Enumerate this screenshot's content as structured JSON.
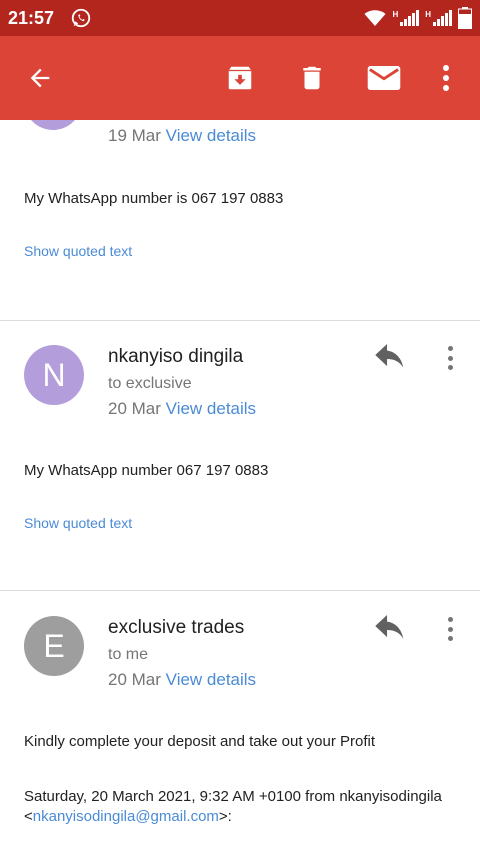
{
  "status_bar": {
    "time": "21:57",
    "network_label": "H"
  },
  "app_bar": {
    "back_icon": "arrow-back-icon",
    "archive_icon": "archive-icon",
    "delete_icon": "trash-icon",
    "mark_unread_icon": "mail-icon",
    "more_icon": "more-vert-icon"
  },
  "messages": [
    {
      "date": "19 Mar",
      "view_details": "View details",
      "body": "My WhatsApp number is 067 197 0883",
      "show_quoted": "Show quoted text"
    },
    {
      "avatar_letter": "N",
      "avatar_color": "#b39ddb",
      "sender": "nkanyiso dingila",
      "recipient": "to exclusive",
      "date": "20 Mar",
      "view_details": "View details",
      "body": "My WhatsApp number 067 197 0883",
      "show_quoted": "Show quoted text"
    },
    {
      "avatar_letter": "E",
      "avatar_color": "#9e9e9e",
      "sender": "exclusive trades",
      "recipient": "to me",
      "date": "20 Mar",
      "view_details": "View details",
      "body": "Kindly complete your deposit and take out your Profit",
      "quote_header_prefix": "Saturday, 20 March 2021, 9:32 AM +0100 from nkanyisodingila",
      "quote_header_open": "<",
      "quote_header_email": "nkanyisodingila@gmail.com",
      "quote_header_close": ">:"
    }
  ],
  "colors": {
    "app_bar": "#db4437",
    "status_bar": "#b3261e",
    "link": "#4a8bd6"
  }
}
